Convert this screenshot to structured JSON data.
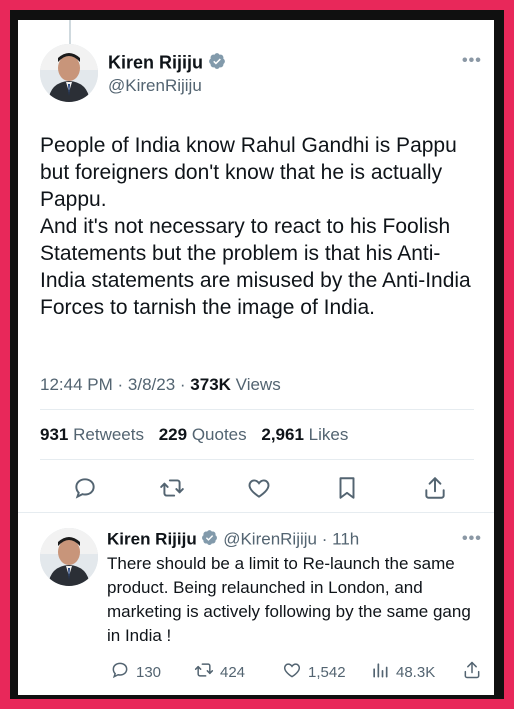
{
  "main_tweet": {
    "author_name": "Kiren Rijiju",
    "author_handle": "@KirenRijiju",
    "more_label": "•••",
    "paragraphs": [
      "People of India know Rahul Gandhi is Pappu but foreigners don't know that he is actually Pappu.",
      "And it's not necessary to react to his Foolish Statements but the problem is that his Anti-India statements are misused by the Anti-India Forces to tarnish the image of India."
    ],
    "time": "12:44 PM",
    "date": "3/8/23",
    "views_count": "373K",
    "views_label": "Views",
    "retweets_count": "931",
    "retweets_label": "Retweets",
    "quotes_count": "229",
    "quotes_label": "Quotes",
    "likes_count": "2,961",
    "likes_label": "Likes",
    "actions": [
      "reply-icon",
      "retweet-icon",
      "like-icon",
      "bookmark-icon",
      "share-icon"
    ]
  },
  "reply_tweet": {
    "author_name": "Kiren Rijiju",
    "author_handle": "@KirenRijiju",
    "age": "11h",
    "more_label": "•••",
    "text": "There should be a limit to Re-launch the same product. Being relaunched in London, and marketing is actively following by the same gang in India !",
    "replies": "130",
    "retweets": "424",
    "likes": "1,542",
    "views": "48.3K"
  },
  "colors": {
    "border": "#e8285a",
    "verified": "#829aab",
    "text": "#0f1419",
    "muted": "#536471"
  }
}
